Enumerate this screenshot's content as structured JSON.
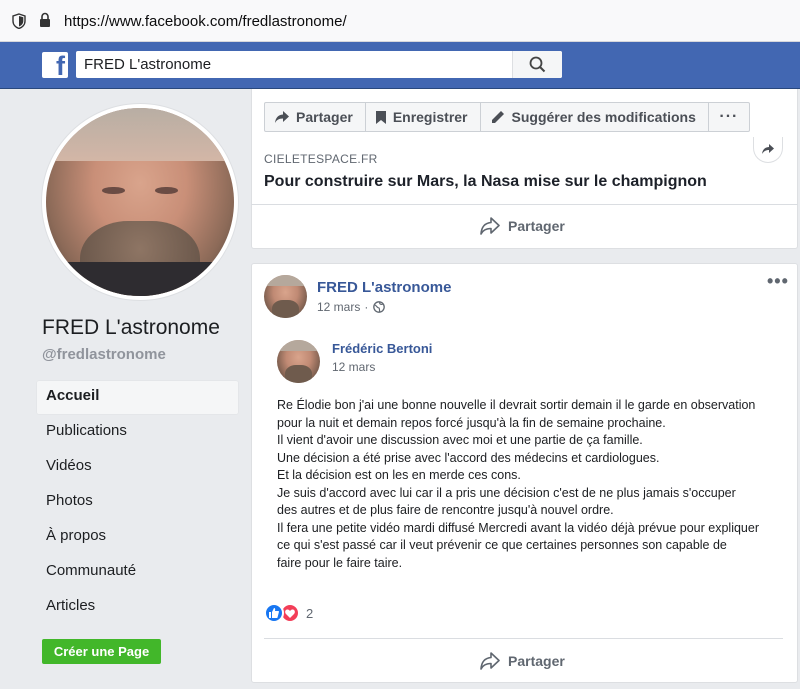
{
  "browser": {
    "url": "https://www.facebook.com/fredlastronome/"
  },
  "header": {
    "logo_icon": "facebook-f-icon",
    "search_value": "FRED L'astronome",
    "brand_color": "#4267b2"
  },
  "profile": {
    "name": "FRED L'astronome",
    "handle": "@fredlastronome"
  },
  "nav": {
    "items": [
      {
        "label": "Accueil",
        "active": true
      },
      {
        "label": "Publications"
      },
      {
        "label": "Vidéos"
      },
      {
        "label": "Photos"
      },
      {
        "label": "À propos"
      },
      {
        "label": "Communauté"
      },
      {
        "label": "Articles"
      }
    ]
  },
  "create_page_label": "Créer une Page",
  "actions": {
    "share": "Partager",
    "save": "Enregistrer",
    "suggest": "Suggérer des modifications",
    "more": "···"
  },
  "link_post": {
    "source": "CIELETESPACE.FR",
    "title": "Pour construire sur Mars, la Nasa mise sur le champignon",
    "share_label": "Partager"
  },
  "post": {
    "author": "FRED L'astronome",
    "date": "12 mars",
    "menu": "•••",
    "shared_author": "Frédéric Bertoni",
    "shared_date": "12 mars",
    "text_lines": [
      "Re Élodie bon j'ai une bonne nouvelle il devrait sortir demain il le garde en observation",
      "pour la nuit et demain repos forcé jusqu'à la fin de semaine prochaine.",
      "Il vient d'avoir une discussion avec moi et une partie de ça famille.",
      "Une décision a été prise avec l'accord des médecins et cardiologues.",
      "Et la décision est on les en merde ces cons.",
      "Je suis d'accord avec lui car il a pris une décision c'est de ne plus jamais s'occuper",
      "des autres et de plus faire de rencontre jusqu'à nouvel ordre.",
      "Il fera une petite vidéo mardi diffusé Mercredi avant la vidéo déjà prévue pour expliquer",
      "ce qui s'est passé car il veut prévenir ce que certaines personnes son capable de",
      "faire pour le faire taire."
    ],
    "reaction_count": "2",
    "share_label": "Partager"
  }
}
